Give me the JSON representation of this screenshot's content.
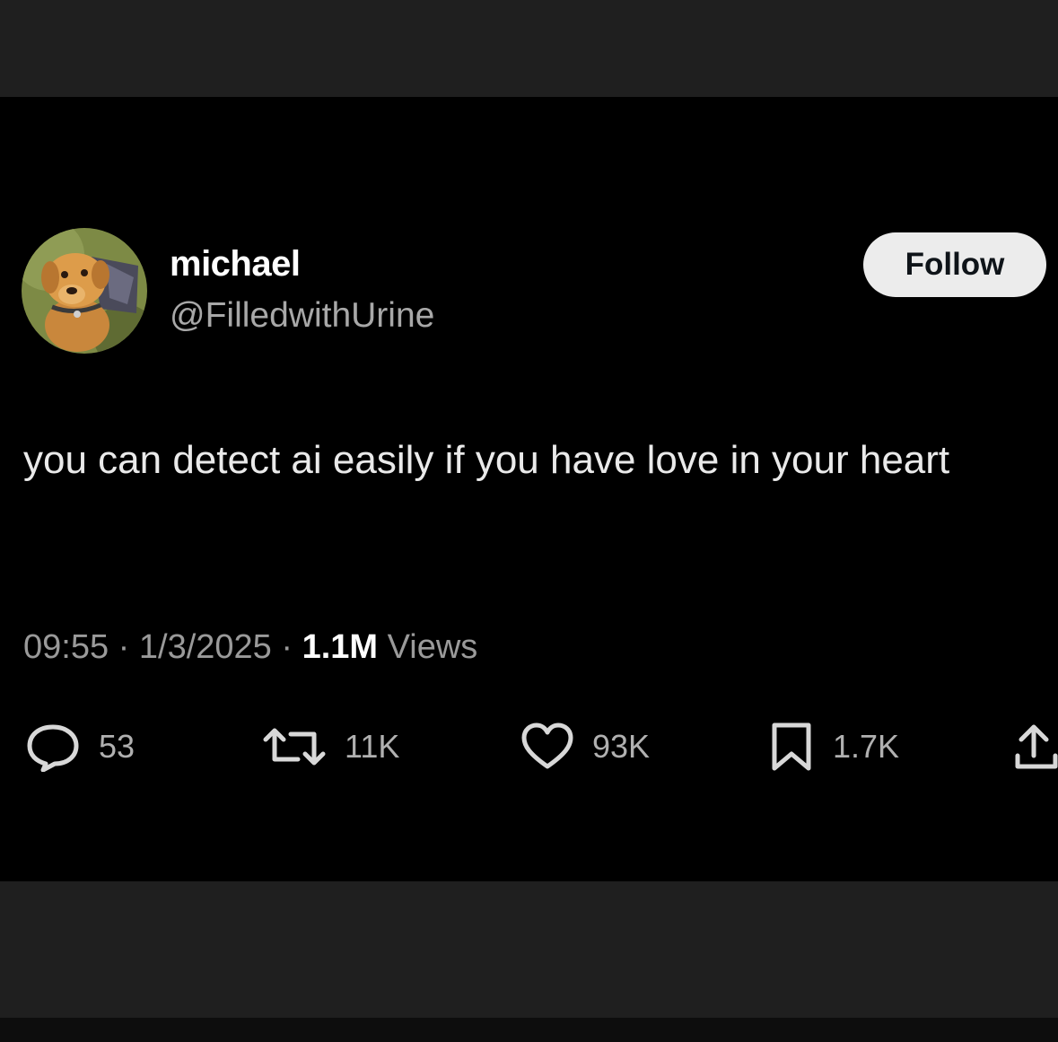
{
  "tweet": {
    "author": {
      "display_name": "michael",
      "handle": "@FilledwithUrine",
      "avatar_icon": "plush-dog-avatar"
    },
    "follow_label": "Follow",
    "text": "you can detect ai easily if you have love in your heart",
    "meta": {
      "time": "09:55",
      "separator": "·",
      "date": "1/3/2025",
      "views_count": "1.1M",
      "views_label": "Views"
    },
    "actions": {
      "reply": {
        "icon": "reply-bubble-icon",
        "count": "53"
      },
      "repost": {
        "icon": "repost-arrows-icon",
        "count": "11K"
      },
      "like": {
        "icon": "heart-icon",
        "count": "93K"
      },
      "bookmark": {
        "icon": "bookmark-icon",
        "count": "1.7K"
      },
      "share": {
        "icon": "share-upload-icon"
      }
    }
  },
  "colors": {
    "tweet_background": "#000000",
    "frame_background": "#1f1f1f",
    "primary_text": "#eaeaea",
    "secondary_text": "#9a9a9a",
    "follow_button": "#ececec"
  }
}
